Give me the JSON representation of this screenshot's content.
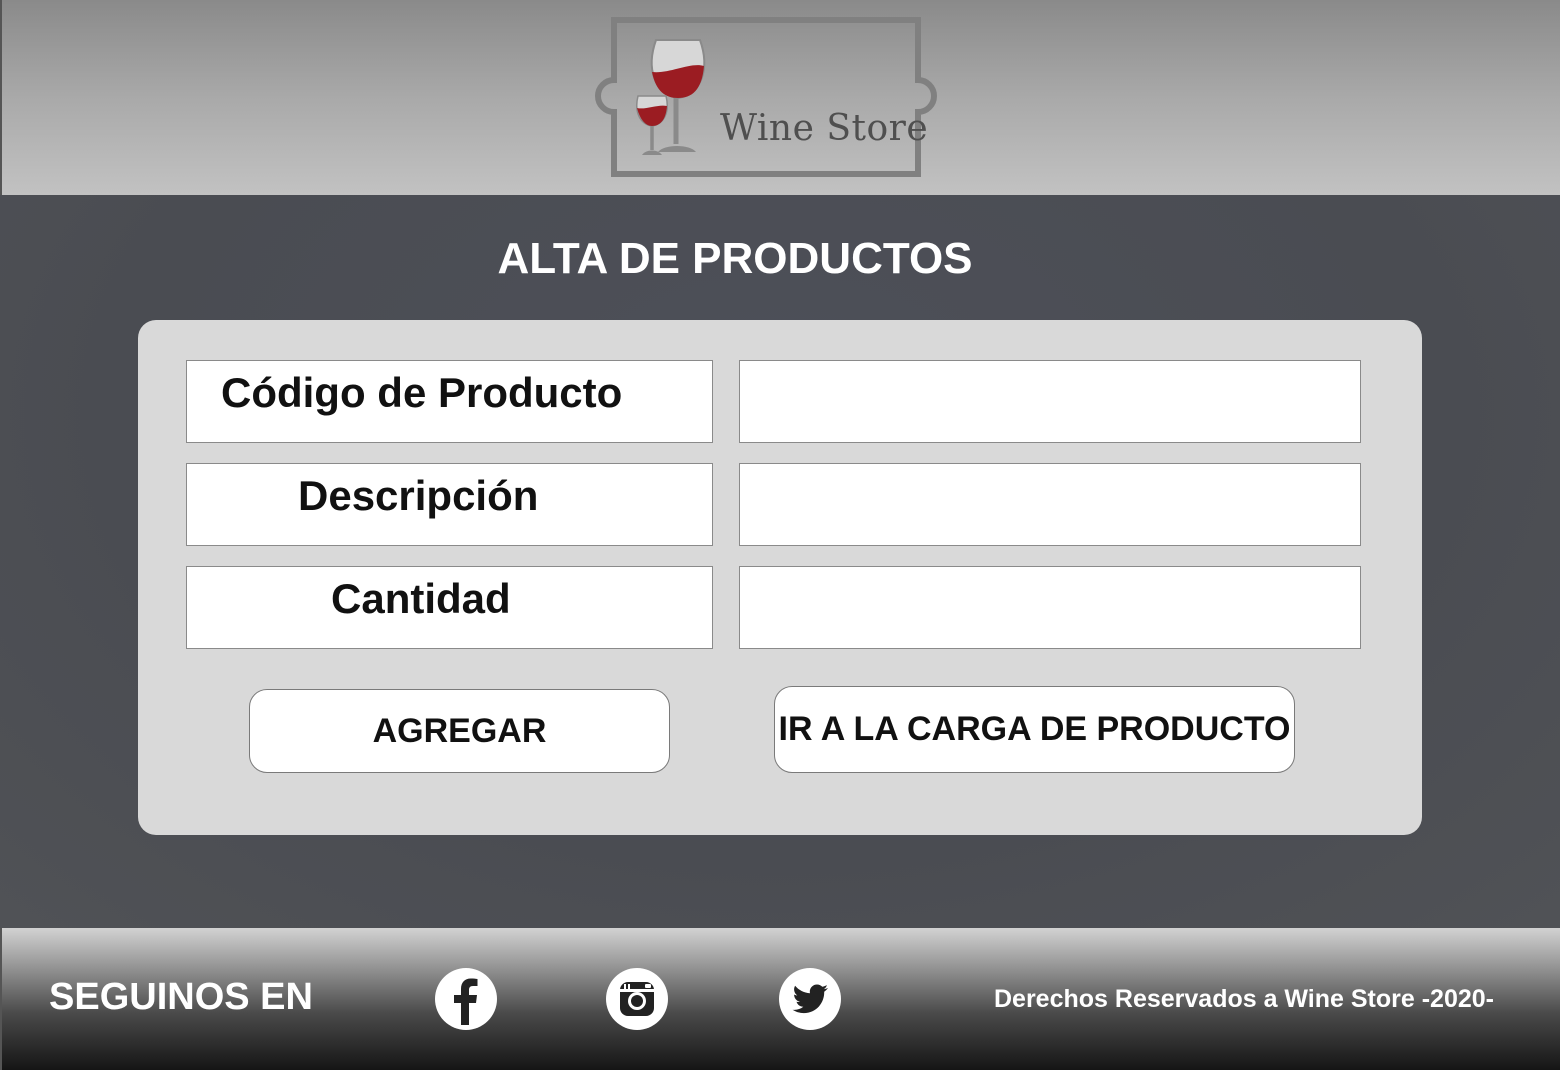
{
  "header": {
    "logo_text": "Wine Store"
  },
  "page": {
    "title": "ALTA DE PRODUCTOS"
  },
  "form": {
    "fields": [
      {
        "label": "Código de Producto",
        "value": ""
      },
      {
        "label": "Descripción",
        "value": ""
      },
      {
        "label": "Cantidad",
        "value": ""
      }
    ],
    "add_button": "AGREGAR",
    "go_button": "IR A LA CARGA DE PRODUCTO"
  },
  "footer": {
    "follow_label": "SEGUINOS EN",
    "social": [
      "facebook-icon",
      "instagram-icon",
      "twitter-icon"
    ],
    "copyright": "Derechos Reservados a Wine Store -2020-"
  },
  "colors": {
    "header_bg": "#a9a9a9",
    "main_bg": "#4b4d53",
    "card_bg": "#d9d9d9",
    "wine": "#9b1c22"
  }
}
